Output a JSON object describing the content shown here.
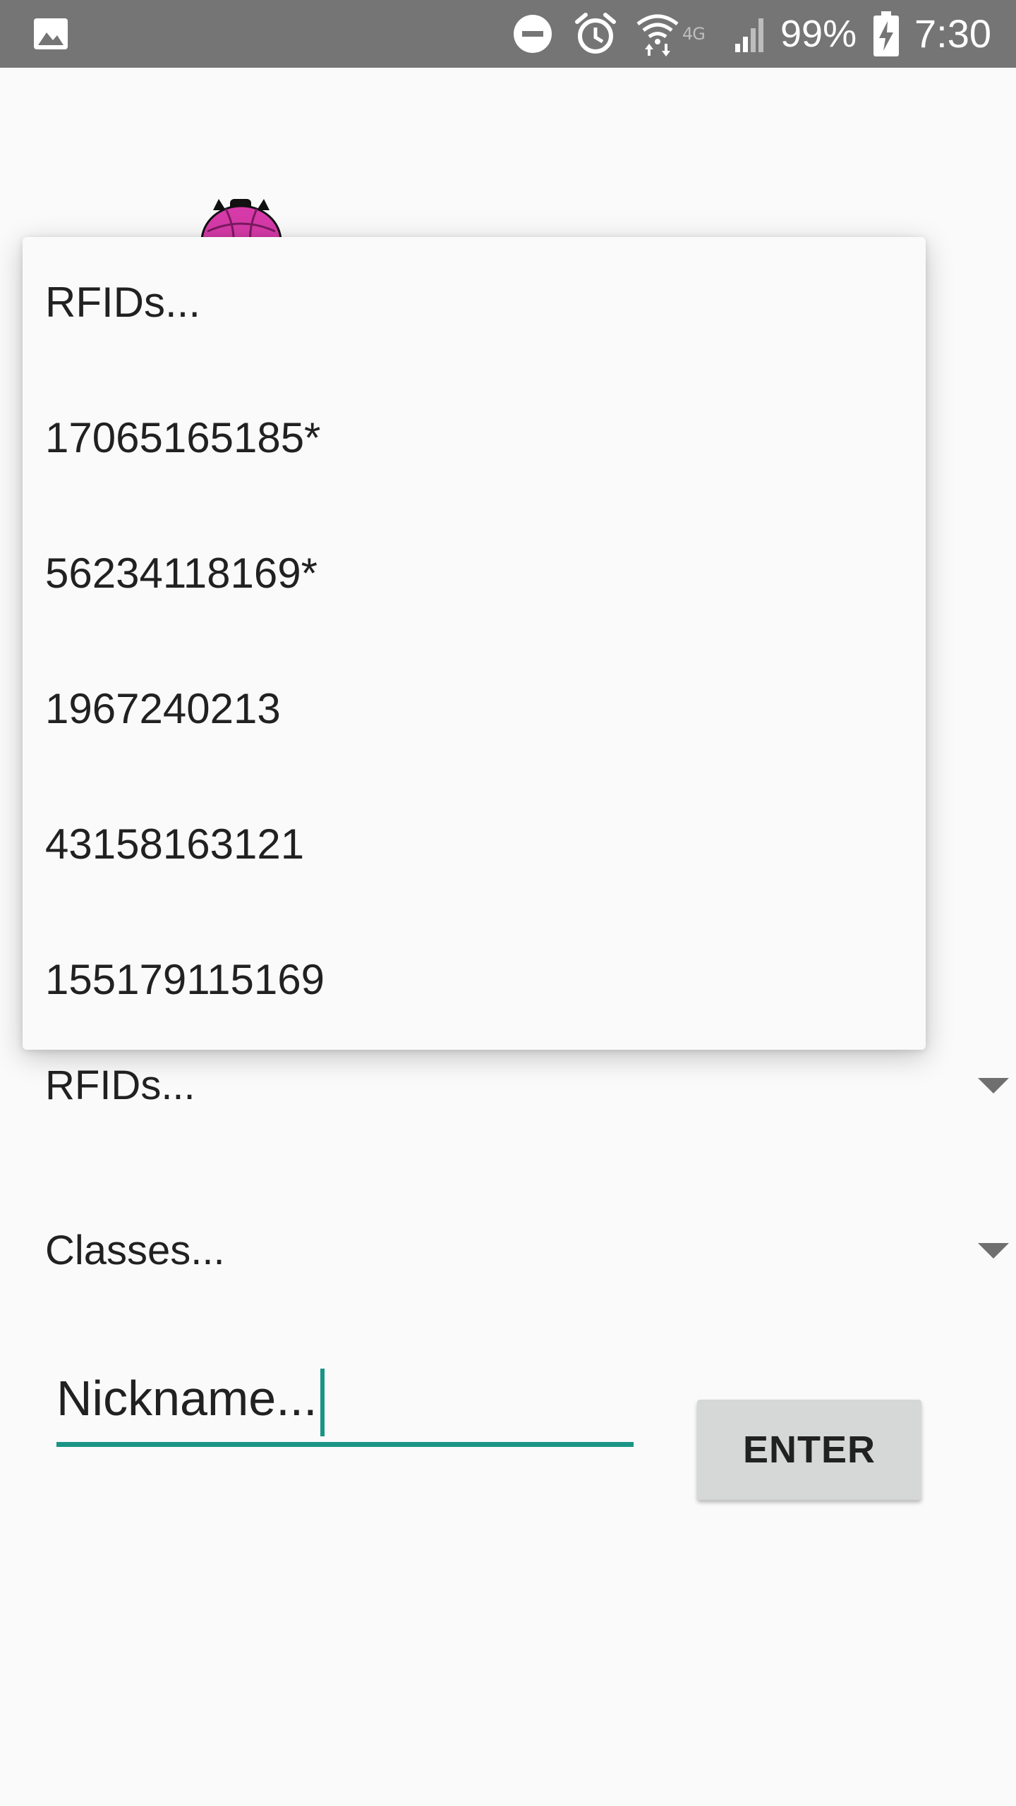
{
  "status_bar": {
    "icons": {
      "gallery": "gallery-notification-icon",
      "dnd": "do-not-disturb-icon",
      "alarm": "alarm-clock-icon",
      "wifi": "wifi-data-icon",
      "signal": "cell-signal-icon",
      "battery": "battery-charging-icon"
    },
    "network_type": "4G",
    "battery_percent": "99%",
    "time": "7:30"
  },
  "logo": {
    "icon": "app-logo-icon",
    "color": "#d63aa8"
  },
  "dropdown": {
    "items": [
      {
        "label": "RFIDs..."
      },
      {
        "label": "17065165185*"
      },
      {
        "label": "56234118169*"
      },
      {
        "label": "1967240213"
      },
      {
        "label": "43158163121"
      },
      {
        "label": "155179115169"
      }
    ]
  },
  "form": {
    "rfid_spinner": {
      "value": "RFIDs..."
    },
    "class_spinner": {
      "value": "Classes..."
    },
    "nickname": {
      "value": "Nickname..."
    },
    "enter_label": "ENTER"
  },
  "colors": {
    "accent": "#1a9486",
    "status_bar": "#757575",
    "background": "#fafafa",
    "button": "#d6d7d7"
  }
}
